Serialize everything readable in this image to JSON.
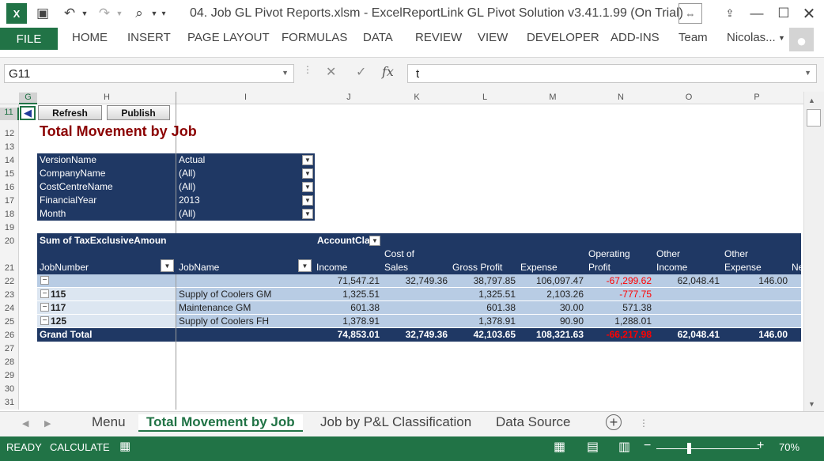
{
  "window": {
    "title": "04. Job GL Pivot Reports.xlsm - ExcelReportLink GL Pivot Solution v3.41.1.99 (On Trial)"
  },
  "ribbon": {
    "file": "FILE",
    "tabs": [
      "HOME",
      "INSERT",
      "PAGE LAYOUT",
      "FORMULAS",
      "DATA",
      "REVIEW",
      "VIEW",
      "DEVELOPER",
      "ADD-INS",
      "Team"
    ],
    "user": "Nicolas..."
  },
  "formula_bar": {
    "name_box": "G11",
    "formula": "t"
  },
  "columns": [
    "G",
    "H",
    "I",
    "J",
    "K",
    "L",
    "M",
    "N",
    "O",
    "P"
  ],
  "rows": [
    "11",
    "12",
    "13",
    "14",
    "15",
    "16",
    "17",
    "18",
    "19",
    "20",
    "21",
    "22",
    "23",
    "24",
    "25",
    "26",
    "27",
    "28",
    "29",
    "30",
    "31"
  ],
  "buttons": {
    "nav": "◀",
    "refresh": "Refresh",
    "publish": "Publish"
  },
  "report_title": "Total Movement by Job",
  "filters": [
    {
      "name": "VersionName",
      "value": "Actual"
    },
    {
      "name": "CompanyName",
      "value": "(All)"
    },
    {
      "name": "CostCentreName",
      "value": "(All)"
    },
    {
      "name": "FinancialYear",
      "value": "2013"
    },
    {
      "name": "Month",
      "value": "(All)"
    }
  ],
  "pivot": {
    "sum_label": "Sum of TaxExclusiveAmoun",
    "account_label": "AccountCla",
    "row_headers": [
      "JobNumber",
      "JobName"
    ],
    "value_headers": [
      [
        "Income"
      ],
      [
        "Cost of",
        "Sales"
      ],
      [
        "Gross Profit"
      ],
      [
        "Expense"
      ],
      [
        "Operating",
        "Profit"
      ],
      [
        "Other",
        "Income"
      ],
      [
        "Other",
        "Expense"
      ],
      [
        "Ne"
      ]
    ],
    "rows": [
      {
        "job": "",
        "name": "",
        "values": [
          "71,547.21",
          "32,749.36",
          "38,797.85",
          "106,097.47",
          "-67,299.62",
          "62,048.41",
          "146.00"
        ]
      },
      {
        "job": "115",
        "name": "Supply of Coolers GM",
        "values": [
          "1,325.51",
          "",
          "1,325.51",
          "2,103.26",
          "-777.75",
          "",
          ""
        ]
      },
      {
        "job": "117",
        "name": "Maintenance GM",
        "values": [
          "601.38",
          "",
          "601.38",
          "30.00",
          "571.38",
          "",
          ""
        ]
      },
      {
        "job": "125",
        "name": "Supply of Coolers FH",
        "values": [
          "1,378.91",
          "",
          "1,378.91",
          "90.90",
          "1,288.01",
          "",
          ""
        ]
      }
    ],
    "total": {
      "label": "Grand Total",
      "values": [
        "74,853.01",
        "32,749.36",
        "42,103.65",
        "108,321.63",
        "-66,217.98",
        "62,048.41",
        "146.00"
      ]
    }
  },
  "sheets": [
    "Menu",
    "Total Movement by Job",
    "Job by P&L Classification",
    "Data Source"
  ],
  "status": {
    "ready": "READY",
    "calc": "CALCULATE",
    "zoom": "70%"
  },
  "colors": {
    "excel_green": "#217346",
    "pivot_navy": "#1f3864",
    "title_red": "#8b0000",
    "negative_red": "#ff0000"
  }
}
